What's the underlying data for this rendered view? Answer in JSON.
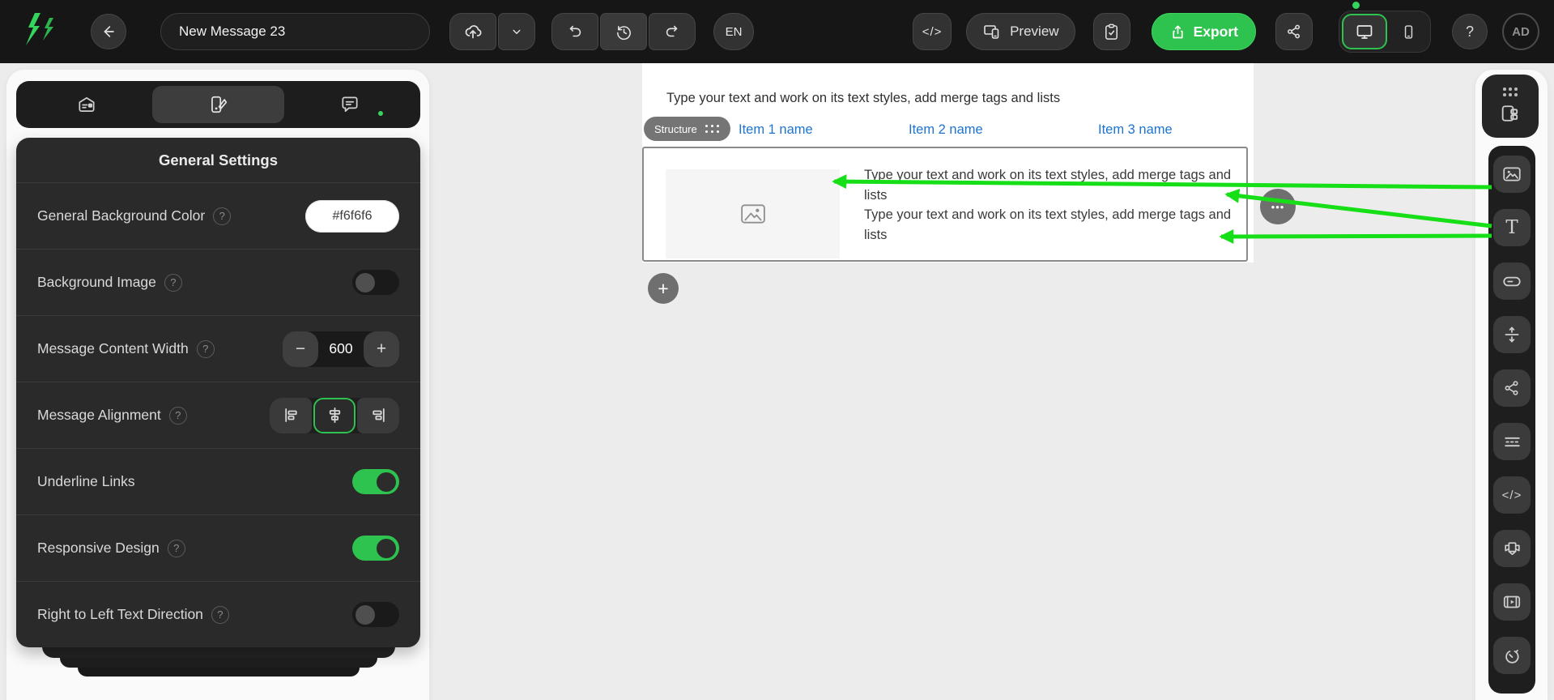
{
  "colors": {
    "export_green": "#2ec24e",
    "toggle_green": "#2ec24e",
    "arrow_green": "#17df17",
    "link_blue": "#1d74d2",
    "general_background_value": "#f6f6f6"
  },
  "glyphs": {
    "question": "?",
    "minus": "−",
    "plus": "+",
    "add": "+",
    "more": "•••",
    "code": "</>",
    "text_block": "T"
  },
  "topbar": {
    "document_title": "New Message 23",
    "language": "EN",
    "preview_label": "Preview",
    "export_label": "Export",
    "avatar_initials": "AD"
  },
  "left_panel": {
    "tabs": [
      {
        "name": "content",
        "selected": false
      },
      {
        "name": "appearance",
        "selected": true
      },
      {
        "name": "comments",
        "selected": false
      }
    ],
    "title": "General Settings",
    "rows": [
      {
        "label": "General Background Color",
        "has_help": true,
        "control": "color-value",
        "value": "#f6f6f6"
      },
      {
        "label": "Background Image",
        "has_help": true,
        "control": "toggle",
        "state": "off"
      },
      {
        "label": "Message Content Width",
        "has_help": true,
        "control": "stepper",
        "value": "600"
      },
      {
        "label": "Message Alignment",
        "has_help": true,
        "control": "segmented",
        "options": [
          "left",
          "center",
          "right"
        ],
        "selected": "center"
      },
      {
        "label": "Underline Links",
        "has_help": false,
        "control": "toggle",
        "state": "on"
      },
      {
        "label": "Responsive Design",
        "has_help": true,
        "control": "toggle",
        "state": "on"
      },
      {
        "label": "Right to Left Text Direction",
        "has_help": true,
        "control": "toggle",
        "state": "off"
      }
    ]
  },
  "canvas": {
    "header_text": "Type your text and work on its text styles, add merge tags and lists",
    "menu_items": [
      "Item 1 name",
      "Item 2 name",
      "Item 3 name"
    ],
    "structure_badge": "Structure",
    "block_paragraphs": [
      "Type your text and work on its text styles, add merge tags and lists",
      "Type your text and work on its text styles, add merge tags and lists"
    ]
  },
  "right_sidebar": {
    "blocks": [
      "structures",
      "image",
      "text",
      "button",
      "spacer",
      "social",
      "menu",
      "html",
      "banner",
      "video",
      "timer"
    ]
  }
}
